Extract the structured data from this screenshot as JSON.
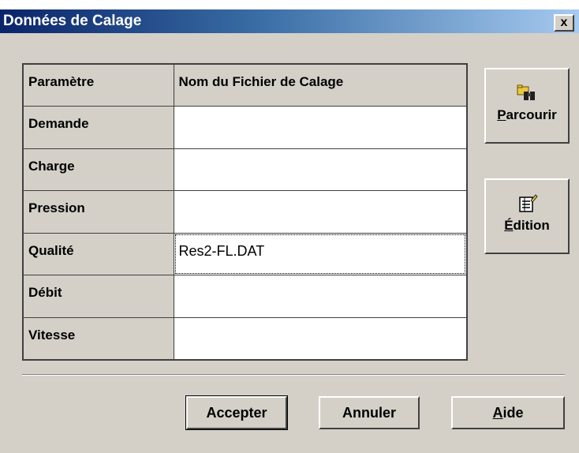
{
  "window": {
    "title": "Données de Calage",
    "close_label": "x"
  },
  "table": {
    "headers": [
      "Paramètre",
      "Nom du Fichier de Calage"
    ],
    "rows": [
      {
        "param": "Demande",
        "file": ""
      },
      {
        "param": "Charge",
        "file": ""
      },
      {
        "param": "Pression",
        "file": ""
      },
      {
        "param": "Qualité",
        "file": "Res2-FL.DAT"
      },
      {
        "param": "Débit",
        "file": ""
      },
      {
        "param": "Vitesse",
        "file": ""
      }
    ]
  },
  "side_buttons": {
    "browse": {
      "label_first": "P",
      "label_rest": "arcourir",
      "icon": "binoculars-folder-icon"
    },
    "edit": {
      "label_first": "É",
      "label_rest": "dition",
      "icon": "edit-document-icon"
    }
  },
  "buttons": {
    "accept": "Accepter",
    "cancel": "Annuler",
    "help_first": "A",
    "help_rest": "ide"
  },
  "colors": {
    "dialog_bg": "#d4d0c8",
    "title_start": "#0a246a",
    "title_end": "#a6caf0"
  }
}
